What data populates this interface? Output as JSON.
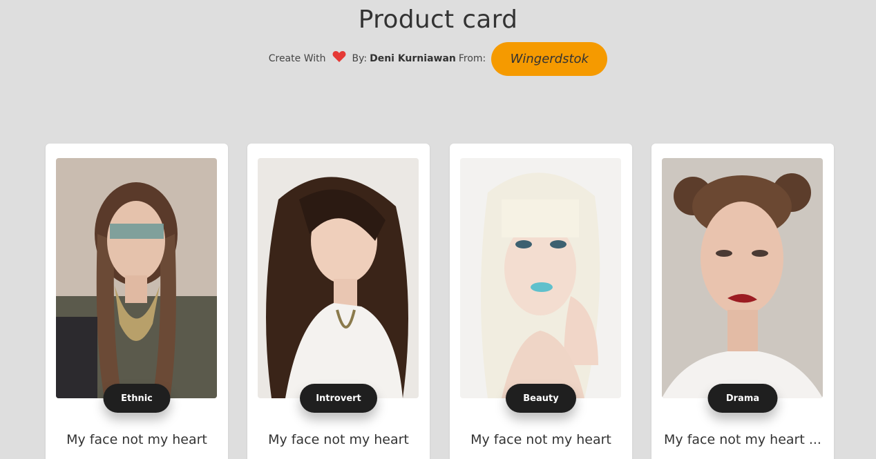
{
  "header": {
    "title": "Product card",
    "create_with": "Create With",
    "heart_icon": "heart-icon",
    "by_label": "By:",
    "author": "Deni Kurniawan",
    "from_label": "From:",
    "source_button": "Wingerdstok"
  },
  "colors": {
    "background": "#dedede",
    "accent": "#f59a00",
    "heart": "#e53935",
    "tag": "#1f1f1f"
  },
  "cards": [
    {
      "tag": "Ethnic",
      "title": "My face not my heart"
    },
    {
      "tag": "Introvert",
      "title": "My face not my heart"
    },
    {
      "tag": "Beauty",
      "title": "My face not my heart"
    },
    {
      "tag": "Drama",
      "title": "My face not my heart ..."
    }
  ]
}
